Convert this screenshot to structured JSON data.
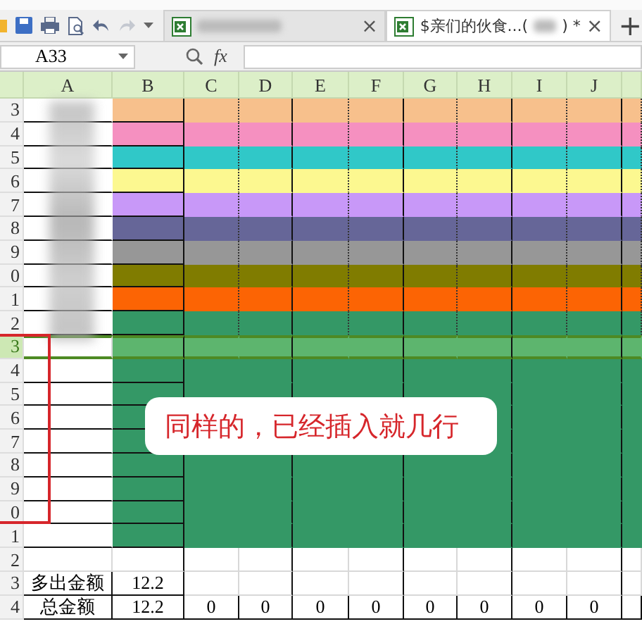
{
  "tabs": [
    {
      "kind": "blurred",
      "selected": false,
      "close": "×"
    },
    {
      "kind": "named",
      "selected": true,
      "title_start": "$亲们的伙食...(",
      "title_end": ") *",
      "close": "×"
    }
  ],
  "new_tab": "+",
  "name_box": "A33",
  "fx": "fx",
  "columns": [
    "A",
    "B",
    "C",
    "D",
    "E",
    "F",
    "G",
    "H",
    "I",
    "J"
  ],
  "rows": [
    {
      "header": "3",
      "kind": "band",
      "color": "#f7c08c",
      "selected": false
    },
    {
      "header": "4",
      "kind": "band",
      "color": "#f590c0",
      "selected": false
    },
    {
      "header": "5",
      "kind": "band",
      "color": "#30c8c8",
      "selected": false
    },
    {
      "header": "6",
      "kind": "band",
      "color": "#fcf890",
      "selected": false
    },
    {
      "header": "7",
      "kind": "band",
      "color": "#c898f8",
      "selected": false
    },
    {
      "header": "8",
      "kind": "band",
      "color": "#666698",
      "selected": false
    },
    {
      "header": "9",
      "kind": "band",
      "color": "#979797",
      "selected": false
    },
    {
      "header": "0",
      "kind": "band",
      "color": "#807c00",
      "selected": false
    },
    {
      "header": "1",
      "kind": "band",
      "color": "#fc6404",
      "selected": false
    },
    {
      "header": "2",
      "kind": "band",
      "color": "#349866",
      "selected": false
    },
    {
      "header": "3",
      "kind": "block",
      "color": "#5db56e",
      "selected": true
    },
    {
      "header": "4",
      "kind": "block",
      "color": "#349866",
      "selected": false
    },
    {
      "header": "5",
      "kind": "block",
      "color": "#349866",
      "selected": false
    },
    {
      "header": "6",
      "kind": "block",
      "color": "#349866",
      "selected": false
    },
    {
      "header": "7",
      "kind": "block",
      "color": "#349866",
      "selected": false
    },
    {
      "header": "8",
      "kind": "block",
      "color": "#349866",
      "selected": false
    },
    {
      "header": "9",
      "kind": "block",
      "color": "#349866",
      "selected": false
    },
    {
      "header": "0",
      "kind": "block",
      "color": "#349866",
      "selected": false
    },
    {
      "header": "1",
      "kind": "block",
      "color": "#349866",
      "selected": false
    },
    {
      "header": "2",
      "kind": "blank",
      "selected": false
    },
    {
      "header": "3",
      "kind": "sum",
      "selected": false,
      "cells": [
        "多出金额",
        "12.2"
      ]
    },
    {
      "header": "4",
      "kind": "sum",
      "selected": false,
      "cells": [
        "总金额",
        "12.2",
        "0",
        "0",
        "0",
        "0",
        "0",
        "0",
        "0",
        "0"
      ]
    }
  ],
  "callout": "同样的，已经插入就几行"
}
